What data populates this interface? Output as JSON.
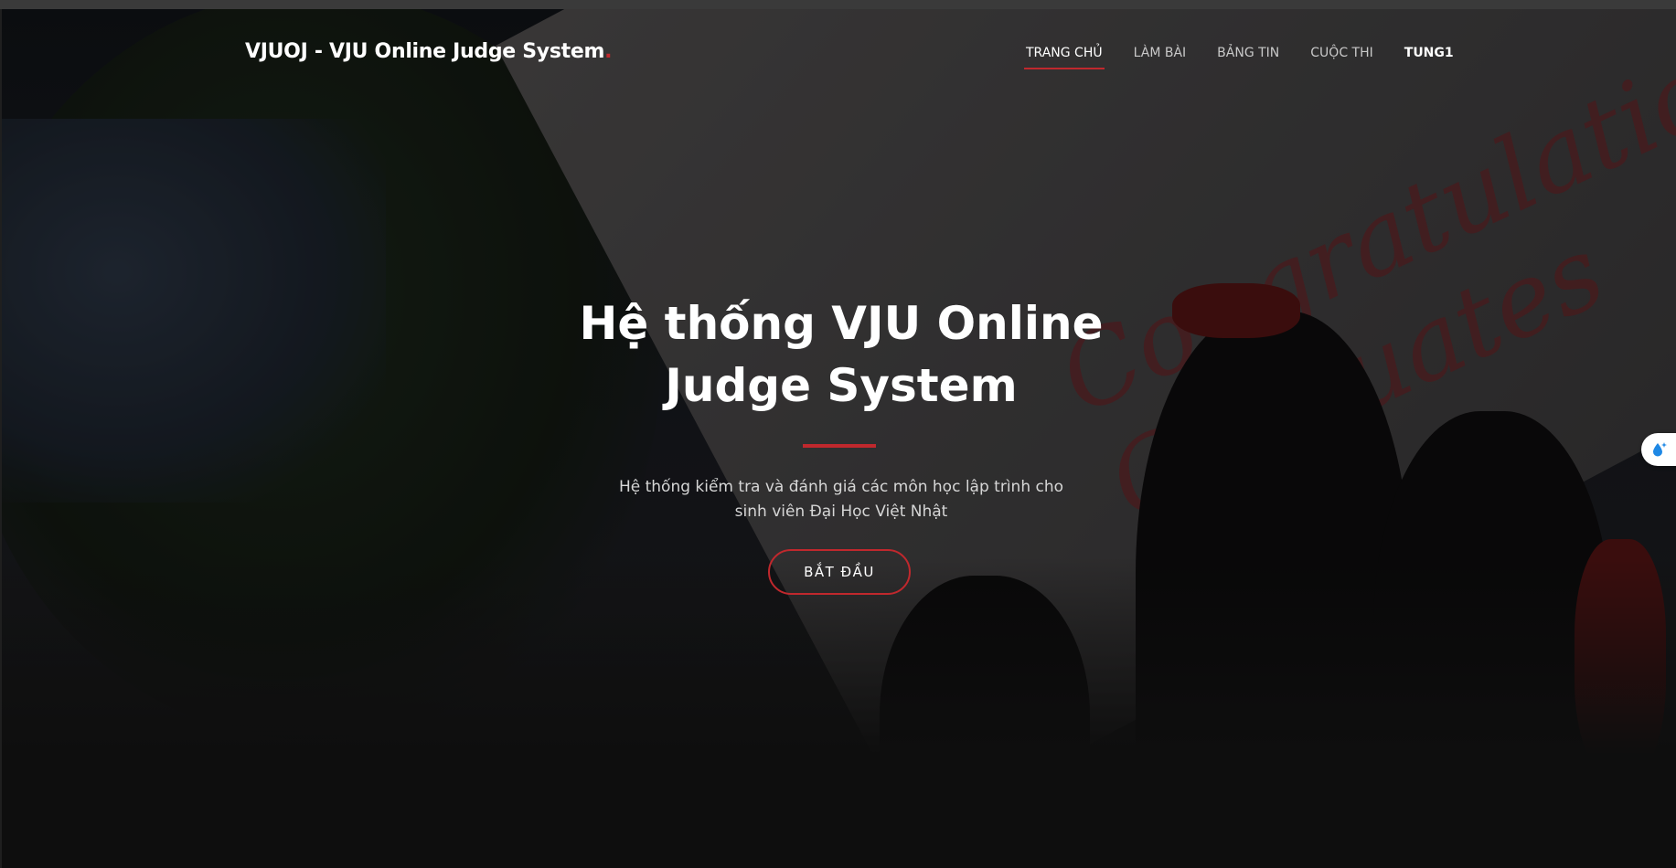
{
  "brand": {
    "name": "VJUOJ - VJU Online Judge System",
    "dot": "."
  },
  "nav": {
    "items": [
      {
        "label": "TRANG CHỦ"
      },
      {
        "label": "LÀM BÀI"
      },
      {
        "label": "BẢNG TIN"
      },
      {
        "label": "CUỘC THI"
      },
      {
        "label": "TUNG1"
      }
    ],
    "active_index": 0
  },
  "hero": {
    "title_line1": "Hệ thống VJU Online",
    "title_line2": "Judge System",
    "subtitle_line1": "Hệ thống kiểm tra và đánh giá các môn học lập trình cho",
    "subtitle_line2": "sinh viên Đại Học Việt Nhật",
    "cta_label": "BẮT ĐẦU"
  },
  "background": {
    "board_text": "Congratulations Graduates"
  },
  "side_widget": {
    "icon": "droplet-sparkle-icon"
  },
  "colors": {
    "accent": "#c0282d",
    "text": "#ffffff",
    "nav_text": "#c9c9c9",
    "subtitle": "#d6d6d6"
  }
}
